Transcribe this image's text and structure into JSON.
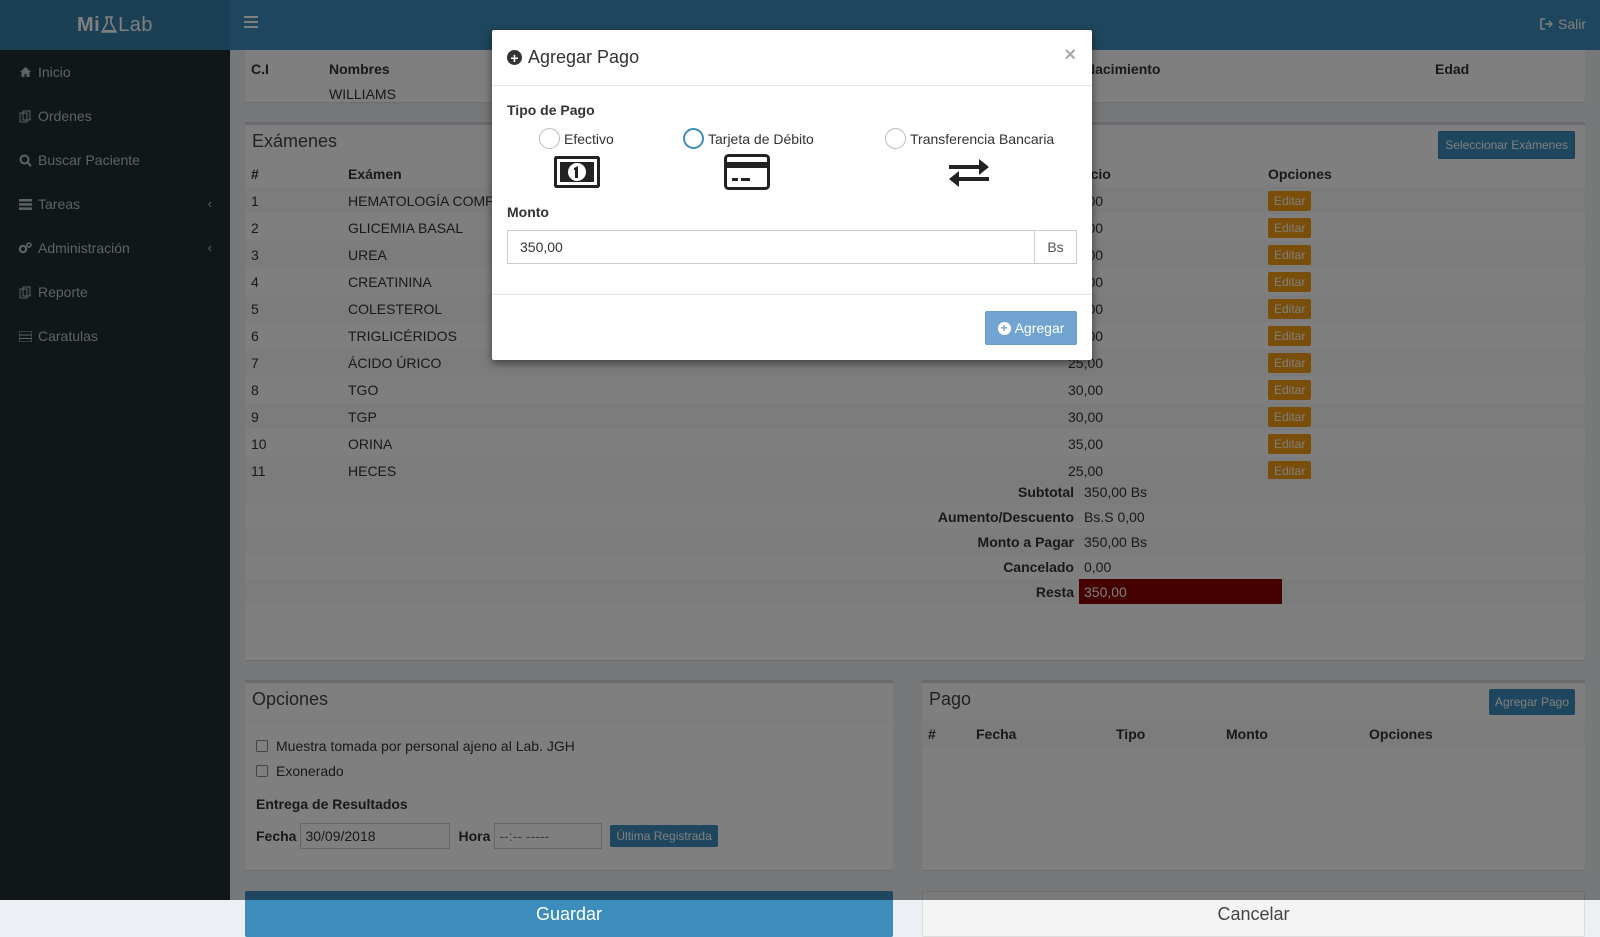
{
  "app": {
    "logo_left": "Mi",
    "logo_right": "Lab",
    "logout_label": "Salir"
  },
  "sidebar": {
    "items": [
      {
        "label": "Inicio",
        "icon": "home-icon"
      },
      {
        "label": "Ordenes",
        "icon": "copy-icon"
      },
      {
        "label": "Buscar Paciente",
        "icon": "search-icon"
      },
      {
        "label": "Tareas",
        "icon": "list-icon",
        "chevron": "‹"
      },
      {
        "label": "Administración",
        "icon": "gears-icon",
        "chevron": "‹"
      },
      {
        "label": "Reporte",
        "icon": "copy-icon"
      },
      {
        "label": "Caratulas",
        "icon": "list-icon"
      }
    ]
  },
  "patient": {
    "headers": [
      "C.I",
      "Nombres",
      "Nacimiento",
      "Edad"
    ],
    "name": "WILLIAMS"
  },
  "exams": {
    "title": "Exámenes",
    "select_button": "Seleccionar Exámenes",
    "headers": [
      "#",
      "Exámen",
      "Precio",
      "Opciones"
    ],
    "rows": [
      {
        "num": "1",
        "name": "HEMATOLOGÍA COMPLETA",
        "price": "40,00"
      },
      {
        "num": "2",
        "name": "GLICEMIA BASAL",
        "price": "25,00"
      },
      {
        "num": "3",
        "name": "UREA",
        "price": "25,00"
      },
      {
        "num": "4",
        "name": "CREATININA",
        "price": "25,00"
      },
      {
        "num": "5",
        "name": "COLESTEROL",
        "price": "30,00"
      },
      {
        "num": "6",
        "name": "TRIGLICÉRIDOS",
        "price": "30,00"
      },
      {
        "num": "7",
        "name": "ÁCIDO ÚRICO",
        "price": "25,00"
      },
      {
        "num": "8",
        "name": "TGO",
        "price": "30,00"
      },
      {
        "num": "9",
        "name": "TGP",
        "price": "30,00"
      },
      {
        "num": "10",
        "name": "ORINA",
        "price": "35,00"
      },
      {
        "num": "11",
        "name": "HECES",
        "price": "25,00"
      }
    ],
    "edit_label": "Editar",
    "totals": [
      {
        "label": "Subtotal",
        "value": "350,00 Bs"
      },
      {
        "label": "Aumento/Descuento",
        "value": "Bs.S 0,00"
      },
      {
        "label": "Monto a Pagar",
        "value": "350,00 Bs"
      },
      {
        "label": "Cancelado",
        "value": "0,00"
      },
      {
        "label": "Resta",
        "value": "350,00"
      }
    ]
  },
  "options": {
    "title": "Opciones",
    "check1": "Muestra tomada por personal ajeno al Lab. JGH",
    "check2": "Exonerado",
    "delivery_title": "Entrega de Resultados",
    "date_label": "Fecha",
    "date_value": "30/09/2018",
    "time_label": "Hora",
    "time_value": "--:-- -----",
    "last_button": "Última Registrada"
  },
  "payments": {
    "title": "Pago",
    "add_button": "Agregar Pago",
    "headers": [
      "#",
      "Fecha",
      "Tipo",
      "Monto",
      "Opciones"
    ]
  },
  "actions": {
    "save": "Guardar",
    "cancel": "Cancelar"
  },
  "modal": {
    "title": "Agregar Pago",
    "close": "×",
    "payment_type_label": "Tipo de Pago",
    "options": [
      "Efectivo",
      "Tarjeta de Débito",
      "Transferencia Bancaria"
    ],
    "amount_label": "Monto",
    "amount_value": "350,00",
    "currency": "Bs",
    "submit": "Agregar"
  },
  "colors": {
    "header": "#3c8dbc",
    "sidebar": "#222d32",
    "edit_button": "#f39c12",
    "resta": "#8b0000"
  }
}
